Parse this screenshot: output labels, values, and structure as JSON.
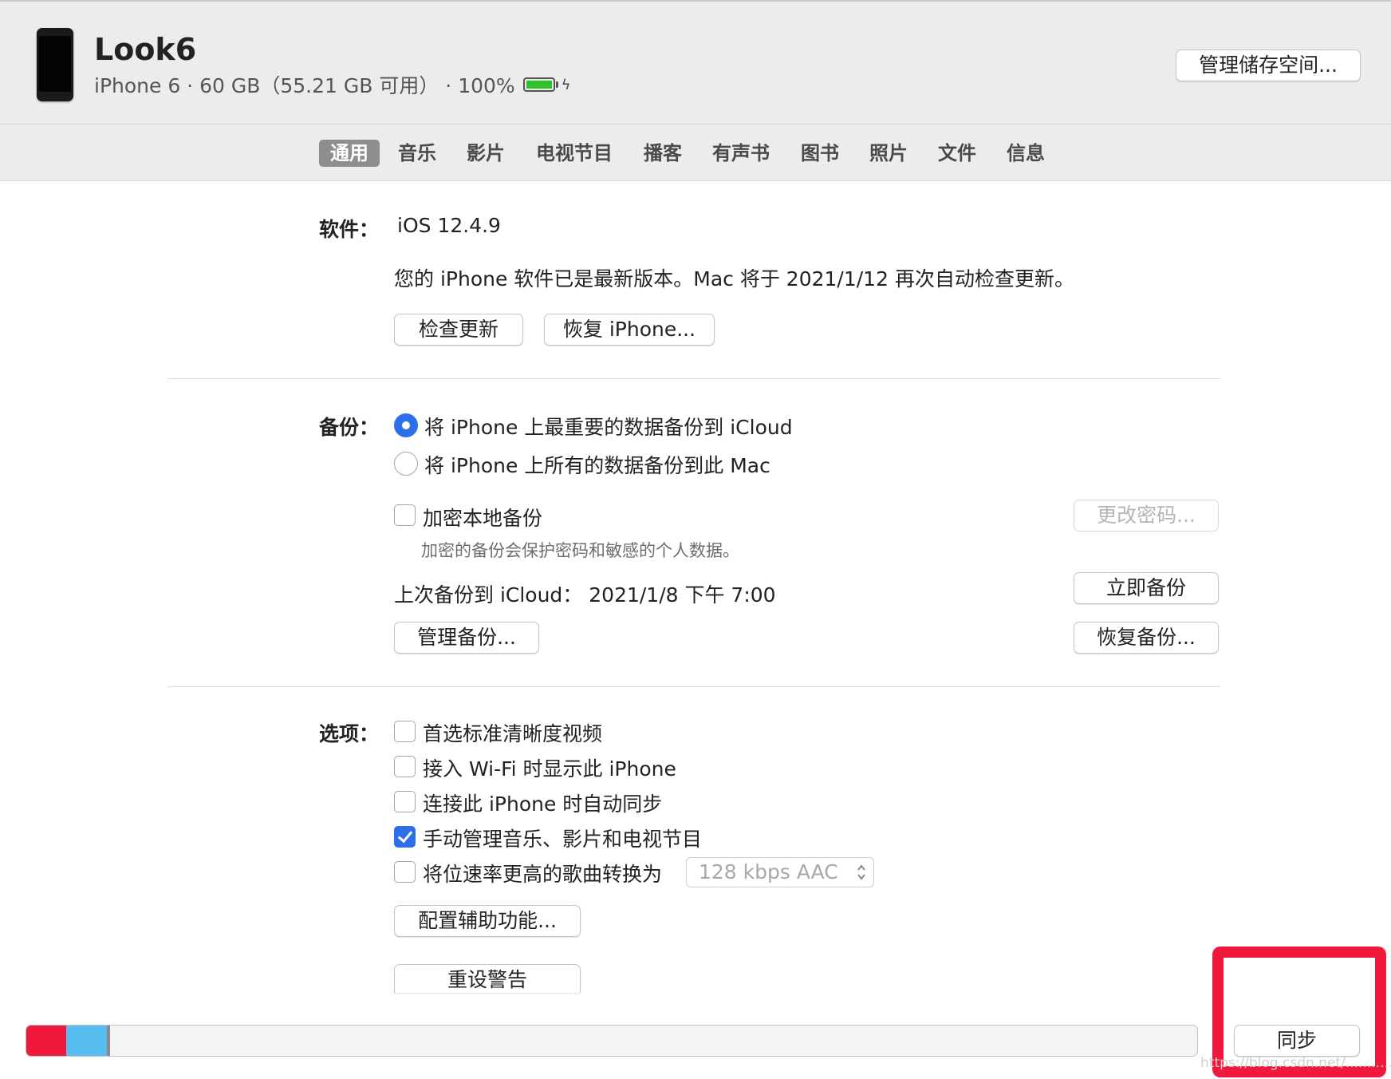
{
  "header": {
    "device_name": "Look6",
    "device_info": "iPhone 6 · 60 GB（55.21 GB 可用） · 100%",
    "battery_percent": 100,
    "battery_color": "#2ec327",
    "manage_storage_label": "管理储存空间..."
  },
  "tabs": [
    {
      "label": "通用",
      "active": true
    },
    {
      "label": "音乐"
    },
    {
      "label": "影片"
    },
    {
      "label": "电视节目"
    },
    {
      "label": "播客"
    },
    {
      "label": "有声书"
    },
    {
      "label": "图书"
    },
    {
      "label": "照片"
    },
    {
      "label": "文件"
    },
    {
      "label": "信息"
    }
  ],
  "software": {
    "label": "软件：",
    "version": "iOS 12.4.9",
    "status": "您的 iPhone 软件已是最新版本。Mac 将于 2021/1/12 再次自动检查更新。",
    "check_update_label": "检查更新",
    "restore_label": "恢复 iPhone..."
  },
  "backup": {
    "label": "备份：",
    "option_icloud": "将 iPhone 上最重要的数据备份到 iCloud",
    "option_mac": "将 iPhone 上所有的数据备份到此 Mac",
    "selected": "icloud",
    "encrypt_label": "加密本地备份",
    "encrypt_checked": false,
    "encrypt_hint": "加密的备份会保护密码和敏感的个人数据。",
    "change_password_label": "更改密码...",
    "last_backup": "上次备份到 iCloud：  2021/1/8 下午 7:00",
    "backup_now_label": "立即备份",
    "manage_backups_label": "管理备份...",
    "restore_backup_label": "恢复备份..."
  },
  "options": {
    "label": "选项：",
    "items": [
      {
        "label": "首选标准清晰度视频",
        "checked": false
      },
      {
        "label": "接入 Wi-Fi 时显示此 iPhone",
        "checked": false
      },
      {
        "label": "连接此 iPhone 时自动同步",
        "checked": false
      },
      {
        "label": "手动管理音乐、影片和电视节目",
        "checked": true
      },
      {
        "label": "将位速率更高的歌曲转换为",
        "checked": false
      }
    ],
    "bitrate_value": "128 kbps AAC",
    "accessibility_label": "配置辅助功能...",
    "reset_warnings_label": "重设警告"
  },
  "footer": {
    "storage_segments": [
      {
        "name": "segment-red",
        "color": "#f0183c",
        "fraction": 0.034
      },
      {
        "name": "segment-blue",
        "color": "#58bdf0",
        "fraction": 0.035
      },
      {
        "name": "segment-gray",
        "color": "#8a8a8a",
        "fraction": 0.003
      }
    ],
    "sync_label": "同步",
    "watermark": "https://blog.csdn.net/...........s"
  },
  "accent_color": "#2d6fe8"
}
